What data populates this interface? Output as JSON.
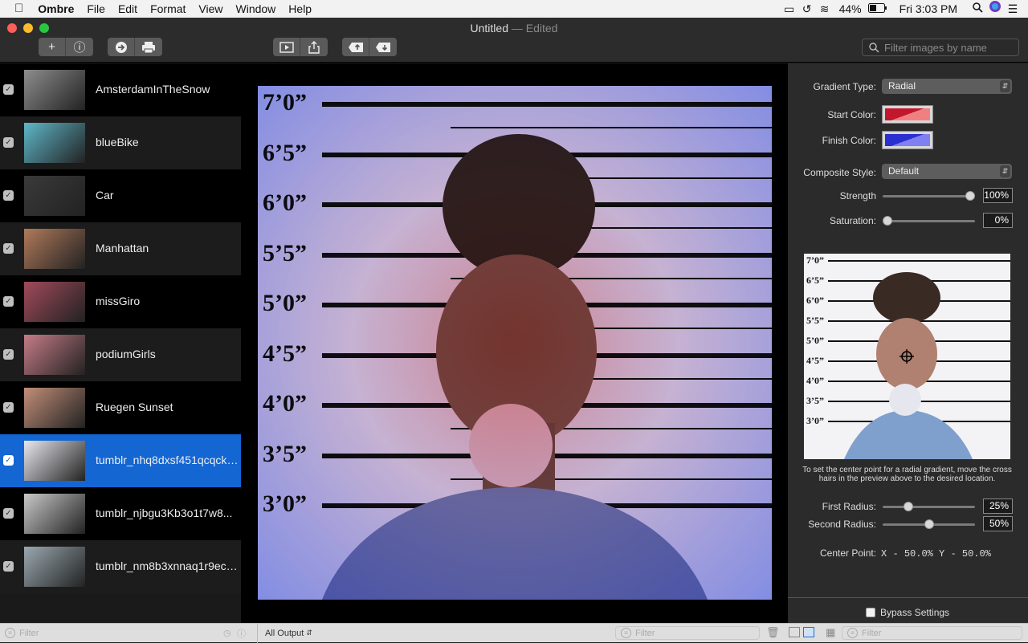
{
  "menubar": {
    "apple": "",
    "app_name": "Ombre",
    "items": [
      "File",
      "Edit",
      "Format",
      "View",
      "Window",
      "Help"
    ],
    "battery": "44%",
    "clock": "Fri 3:03 PM"
  },
  "window": {
    "title": "Untitled",
    "title_suffix": "— Edited"
  },
  "toolbar": {
    "search_placeholder": "Filter images by name"
  },
  "images": [
    {
      "name": "AmsterdamInTheSnow",
      "checked": true,
      "thumb_color": "#8d8d8d"
    },
    {
      "name": "blueBike",
      "checked": true,
      "thumb_color": "#5fb7c9"
    },
    {
      "name": "Car",
      "checked": true,
      "thumb_color": "#3a3a3a"
    },
    {
      "name": "Manhattan",
      "checked": true,
      "thumb_color": "#b07a5a"
    },
    {
      "name": "missGiro",
      "checked": true,
      "thumb_color": "#a04a5a"
    },
    {
      "name": "podiumGirls",
      "checked": true,
      "thumb_color": "#c47c86"
    },
    {
      "name": "Ruegen Sunset",
      "checked": true,
      "thumb_color": "#c28e78"
    },
    {
      "name": "tumblr_nhq8dxsf451qcqckt...",
      "checked": true,
      "thumb_color": "#e8e8ee",
      "selected": true
    },
    {
      "name": "tumblr_njbgu3Kb3o1t7w8...",
      "checked": true,
      "thumb_color": "#c8c8c8"
    },
    {
      "name": "tumblr_nm8b3xnnaq1r9ecc...",
      "checked": true,
      "thumb_color": "#9aa8b0"
    }
  ],
  "preview": {
    "height_labels": [
      "7’0”",
      "6’5”",
      "6’0”",
      "5’5”",
      "5’0”",
      "4’5”",
      "4’0”",
      "3’5”",
      "3’0”"
    ]
  },
  "inspector": {
    "gradient_type_label": "Gradient Type:",
    "gradient_type_value": "Radial",
    "start_color_label": "Start Color:",
    "start_color": "#c2182e",
    "finish_color_label": "Finish Color:",
    "finish_color": "#2a2fd0",
    "composite_style_label": "Composite Style:",
    "composite_style_value": "Default",
    "strength_label": "Strength",
    "strength_value": "100%",
    "strength_level": 1.0,
    "saturation_label": "Saturation:",
    "saturation_value": "0%",
    "saturation_level": 0.0,
    "hint": "To set the center point  for a radial gradient, move the cross hairs in the preview above to the desired location.",
    "first_radius_label": "First Radius:",
    "first_radius_value": "25%",
    "first_radius_level": 0.25,
    "second_radius_label": "Second Radius:",
    "second_radius_value": "50%",
    "second_radius_level": 0.5,
    "center_point_label": "Center Point:",
    "center_point_value": "X - 50.0%  Y - 50.0%",
    "bypass_label": "Bypass Settings"
  },
  "bottombar": {
    "filter_left": "Filter",
    "output_popup": "All Output",
    "filter_mid": "Filter",
    "filter_right": "Filter"
  }
}
